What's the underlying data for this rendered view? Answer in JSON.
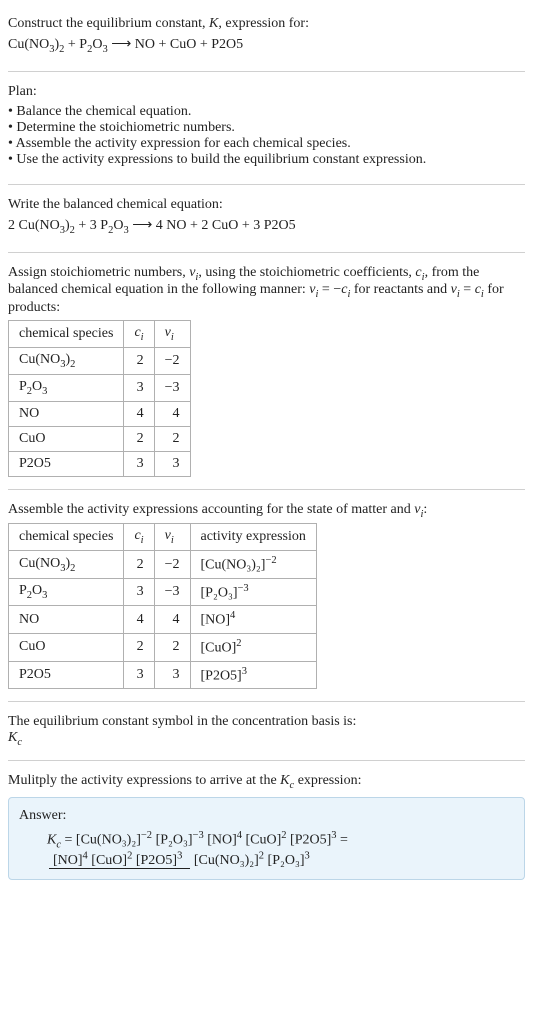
{
  "header": {
    "line1_a": "Construct the equilibrium constant, ",
    "line1_b": ", expression for:",
    "K": "K",
    "eq_l": "Cu(NO",
    "eq": "Cu(NO₃)₂ + P₂O₃ ⟶ NO + CuO + P2O5"
  },
  "plan": {
    "title": "Plan:",
    "items": [
      "Balance the chemical equation.",
      "Determine the stoichiometric numbers.",
      "Assemble the activity expression for each chemical species.",
      "Use the activity expressions to build the equilibrium constant expression."
    ]
  },
  "balanced": {
    "title": "Write the balanced chemical equation:",
    "c1": "2 Cu(NO",
    "c1s": "3",
    "c1t": ")",
    "c1s2": "2",
    "plus1": " + 3 P",
    "p2": "2",
    "o": "O",
    "p3": "3",
    "arrow": " ⟶ 4 NO + 2 CuO + 3 P2O5"
  },
  "assign": {
    "l1a": "Assign stoichiometric numbers, ",
    "nu_i": "ν",
    "sub_i": "i",
    "l1b": ", using the stoichiometric coefficients, ",
    "c_i": "c",
    "l1c": ", from the balanced chemical equation in the following manner: ",
    "rel_r": " = −",
    "for_r": " for reactants and ",
    "rel_p": " = ",
    "for_p": " for products:"
  },
  "table1": {
    "headers": {
      "sp": "chemical species",
      "c": "c",
      "nu": "ν",
      "i": "i"
    },
    "rows": [
      {
        "sp": "Cu(NO₃)₂",
        "c": "2",
        "nu": "−2"
      },
      {
        "sp": "P₂O₃",
        "c": "3",
        "nu": "−3"
      },
      {
        "sp": "NO",
        "c": "4",
        "nu": "4"
      },
      {
        "sp": "CuO",
        "c": "2",
        "nu": "2"
      },
      {
        "sp": "P2O5",
        "c": "3",
        "nu": "3"
      }
    ]
  },
  "assemble": {
    "l1a": "Assemble the activity expressions accounting for the state of matter and ",
    "colon": ":"
  },
  "table2": {
    "headers": {
      "sp": "chemical species",
      "c": "c",
      "nu": "ν",
      "i": "i",
      "act": "activity expression"
    },
    "rows": [
      {
        "sp": "Cu(NO₃)₂",
        "c": "2",
        "nu": "−2",
        "base": "[Cu(NO₃)₂]",
        "exp": "−2"
      },
      {
        "sp": "P₂O₃",
        "c": "3",
        "nu": "−3",
        "base": "[P₂O₃]",
        "exp": "−3"
      },
      {
        "sp": "NO",
        "c": "4",
        "nu": "4",
        "base": "[NO]",
        "exp": "4"
      },
      {
        "sp": "CuO",
        "c": "2",
        "nu": "2",
        "base": "[CuO]",
        "exp": "2"
      },
      {
        "sp": "P2O5",
        "c": "3",
        "nu": "3",
        "base": "[P2O5]",
        "exp": "3"
      }
    ]
  },
  "basis": {
    "l1": "The equilibrium constant symbol in the concentration basis is:",
    "Kc": "K",
    "c": "c"
  },
  "mult": {
    "l1a": "Mulitply the activity expressions to arrive at the ",
    "l1b": " expression:"
  },
  "answer": {
    "label": "Answer:",
    "lhs_K": "K",
    "lhs_c": "c",
    "eq": " = ",
    "t1_b": "[Cu(NO₃)₂]",
    "t1_e": "−2",
    "t2_b": "[P₂O₃]",
    "t2_e": "−3",
    "t3_b": "[NO]",
    "t3_e": "4",
    "t4_b": "[CuO]",
    "t4_e": "2",
    "t5_b": "[P2O5]",
    "t5_e": "3",
    "eq2": " = ",
    "num1_b": "[NO]",
    "num1_e": "4",
    "num2_b": "[CuO]",
    "num2_e": "2",
    "num3_b": "[P2O5]",
    "num3_e": "3",
    "den1_b": "[Cu(NO₃)₂]",
    "den1_e": "2",
    "den2_b": "[P₂O₃]",
    "den2_e": "3"
  },
  "chart_data": {
    "type": "table",
    "tables": [
      {
        "title": "stoichiometric numbers",
        "columns": [
          "chemical species",
          "c_i",
          "ν_i"
        ],
        "rows": [
          [
            "Cu(NO3)2",
            2,
            -2
          ],
          [
            "P2O3",
            3,
            -3
          ],
          [
            "NO",
            4,
            4
          ],
          [
            "CuO",
            2,
            2
          ],
          [
            "P2O5",
            3,
            3
          ]
        ]
      },
      {
        "title": "activity expressions",
        "columns": [
          "chemical species",
          "c_i",
          "ν_i",
          "activity expression"
        ],
        "rows": [
          [
            "Cu(NO3)2",
            2,
            -2,
            "[Cu(NO3)2]^(-2)"
          ],
          [
            "P2O3",
            3,
            -3,
            "[P2O3]^(-3)"
          ],
          [
            "NO",
            4,
            4,
            "[NO]^4"
          ],
          [
            "CuO",
            2,
            2,
            "[CuO]^2"
          ],
          [
            "P2O5",
            3,
            3,
            "[P2O5]^3"
          ]
        ]
      }
    ]
  }
}
